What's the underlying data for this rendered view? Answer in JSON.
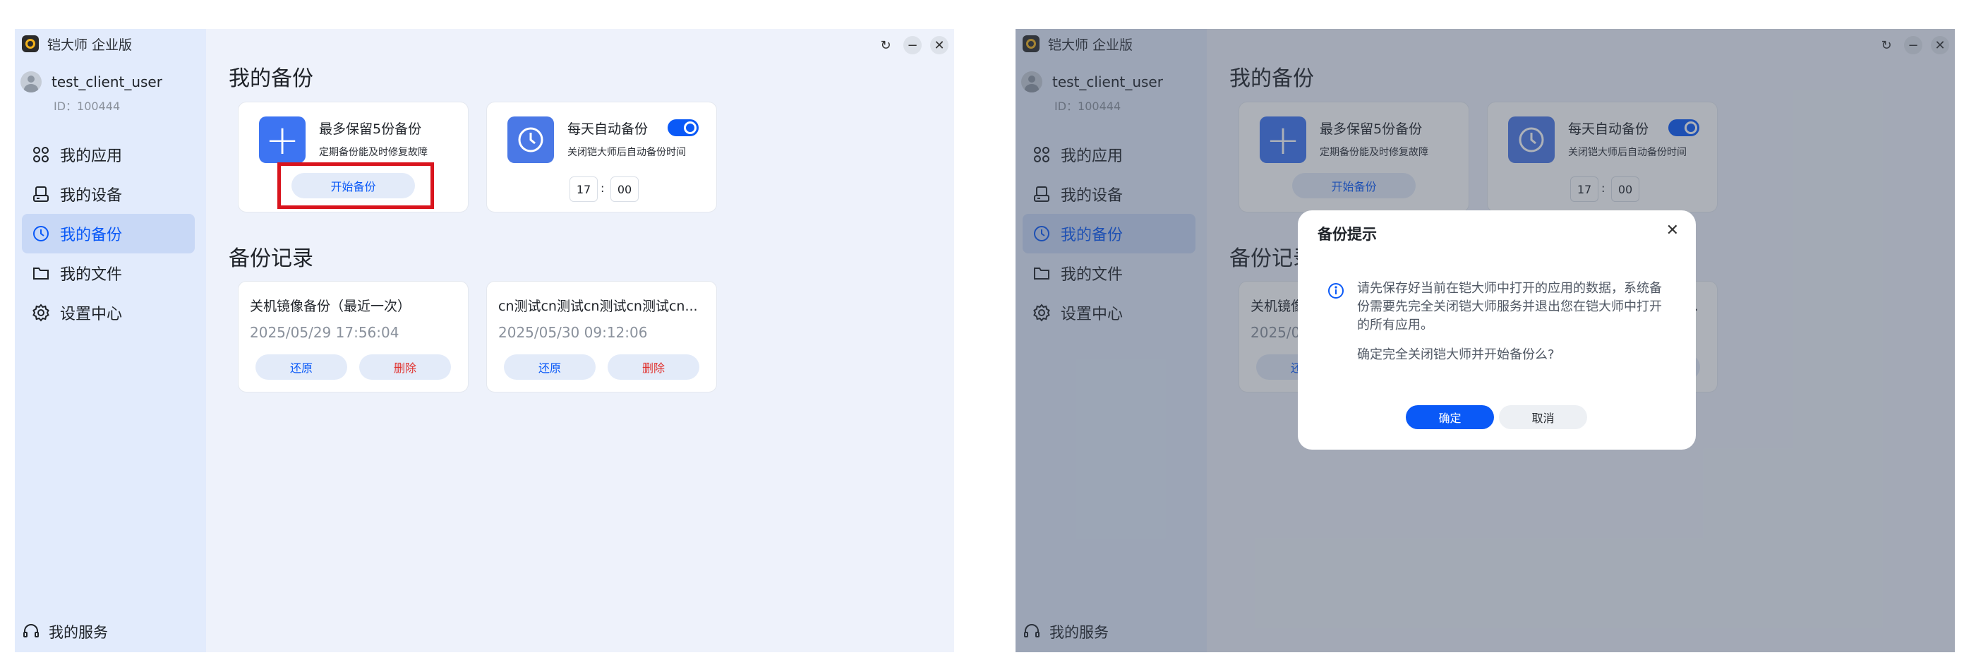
{
  "app": {
    "title": "铠大师 企业版"
  },
  "user": {
    "name": "test_client_user",
    "id": "ID：100444"
  },
  "nav": {
    "items": [
      {
        "label": "我的应用",
        "icon": "apps-icon"
      },
      {
        "label": "我的设备",
        "icon": "device-icon"
      },
      {
        "label": "我的备份",
        "icon": "backup-clock-icon"
      },
      {
        "label": "我的文件",
        "icon": "folder-icon"
      },
      {
        "label": "设置中心",
        "icon": "gear-icon"
      }
    ],
    "active": "我的备份",
    "service_label": "我的服务"
  },
  "window_controls": {
    "refresh": "↻",
    "minimize": "−",
    "close": "✕"
  },
  "backup": {
    "section_title": "我的备份",
    "manual_card": {
      "title": "最多保留5份备份",
      "subtitle": "定期备份能及时修复故障",
      "button": "开始备份"
    },
    "auto_card": {
      "title": "每天自动备份",
      "subtitle": "关闭铠大师后自动备份时间",
      "enabled": true,
      "hour": "17",
      "colon": ":",
      "minute": "00"
    }
  },
  "records": {
    "section_title": "备份记录",
    "items": [
      {
        "title": "关机镜像备份（最近一次）",
        "time": "2025/05/29 17:56:04",
        "restore": "还原",
        "delete": "删除"
      },
      {
        "title": "cn测试cn测试cn测试cn测试cn...",
        "time": "2025/05/30 09:12:06",
        "restore": "还原",
        "delete": "删除"
      }
    ]
  },
  "dialog": {
    "title": "备份提示",
    "close": "✕",
    "message": "请先保存好当前在铠大师中打开的应用的数据，系统备份需要先完全关闭铠大师服务并退出您在铠大师中打开的所有应用。",
    "confirm_question": "确定完全关闭铠大师并开始备份么?",
    "ok": "确定",
    "cancel": "取消"
  },
  "colors": {
    "accent": "#0a59f7",
    "danger": "#e0312e",
    "sidebar": "#e2ebfc",
    "main": "#eef2fb",
    "highlight": "#d9141d"
  }
}
